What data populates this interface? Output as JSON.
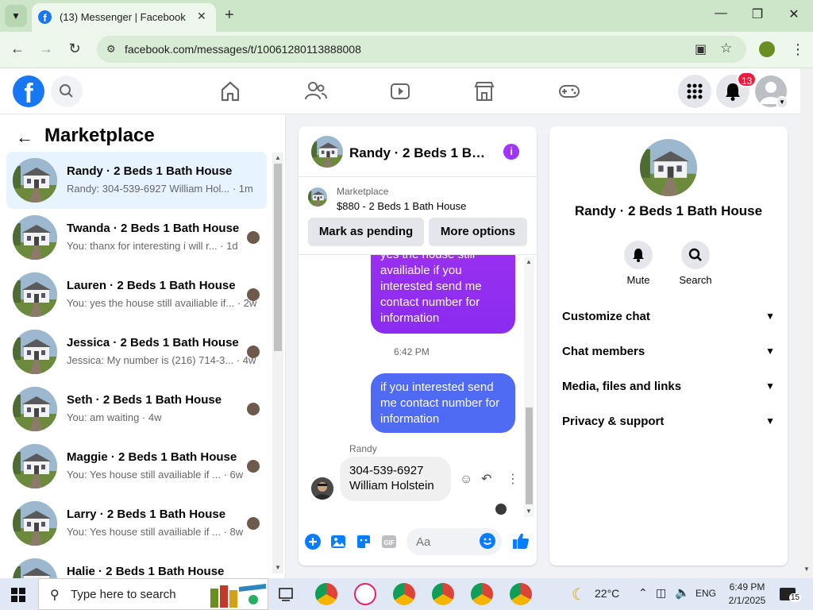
{
  "browser": {
    "tab_title": "(13) Messenger | Facebook",
    "url": "facebook.com/messages/t/10061280113888008"
  },
  "fb_header": {
    "notification_count": "13"
  },
  "left_panel": {
    "title": "Marketplace",
    "conversations": [
      {
        "name": "Randy · 2 Beds 1 Bath House",
        "snippet": "Randy: 304-539-6927 William Hol... · 1m",
        "active": true
      },
      {
        "name": "Twanda · 2 Beds 1 Bath House",
        "snippet": "You: thanx for interesting i will r... · 1d",
        "active": false
      },
      {
        "name": "Lauren · 2 Beds 1 Bath House",
        "snippet": "You: yes the house still availiable if... · 2w",
        "active": false
      },
      {
        "name": "Jessica · 2 Beds 1 Bath House",
        "snippet": "Jessica: My number is (216) 714-3... · 4w",
        "active": false
      },
      {
        "name": "Seth · 2 Beds 1 Bath House",
        "snippet": "You: am waiting · 4w",
        "active": false
      },
      {
        "name": "Maggie · 2 Beds 1 Bath House",
        "snippet": "You: Yes house still availiable if ... · 6w",
        "active": false
      },
      {
        "name": "Larry · 2 Beds 1 Bath House",
        "snippet": "You: Yes house still availiable if ... · 8w",
        "active": false
      },
      {
        "name": "Halie · 2 Beds 1 Bath House",
        "snippet": "",
        "active": false
      }
    ]
  },
  "chat": {
    "title": "Randy · 2 Beds 1 Bat...",
    "listing_kicker": "Marketplace",
    "listing_price": "$880 - 2 Beds 1 Bath House",
    "mark_pending_label": "Mark as pending",
    "more_options_label": "More options",
    "messages": {
      "out1": "yes the house still availiable if you interested send me contact number for information",
      "timestamp": "6:42 PM",
      "out2": "if you interested send me contact number for information",
      "sender": "Randy",
      "in1_line1": "304-539-6927",
      "in1_line2": "William Holstein"
    },
    "composer_placeholder": "Aa"
  },
  "info_panel": {
    "name": "Randy · 2 Beds 1 Bath House",
    "mute_label": "Mute",
    "search_label": "Search",
    "sections": [
      "Customize chat",
      "Chat members",
      "Media, files and links",
      "Privacy & support"
    ]
  },
  "taskbar": {
    "search_placeholder": "Type here to search",
    "weather": "22°C",
    "language": "ENG",
    "time": "6:49 PM",
    "date": "2/1/2025",
    "notification_count": "15"
  },
  "colors": {
    "fb_blue": "#1877f2",
    "active_row": "#e7f3ff",
    "bubble_purple": "#9b31ee",
    "bubble_blue": "#4f6af3",
    "badge_red": "#e41e3f"
  }
}
